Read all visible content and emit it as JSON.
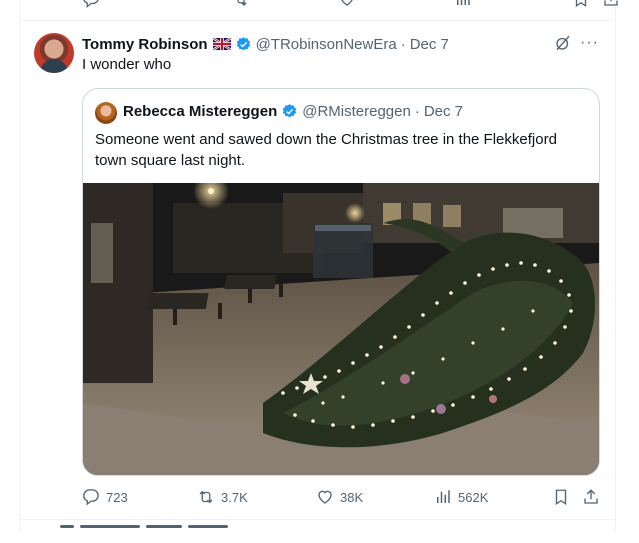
{
  "previous_tweet_bar": {
    "reply_count": "",
    "retweet_count": "",
    "like_count": "",
    "view_count": "",
    "reply_icon": "reply-icon",
    "retweet_icon": "retweet-icon",
    "like_icon": "heart-icon",
    "views_icon": "views-icon"
  },
  "tweet": {
    "author_name": "Tommy Robinson",
    "flag_icon": "uk-flag-icon",
    "verified_icon": "verified-badge-icon",
    "handle": "@TRobinsonNewEra",
    "separator": "·",
    "date": "Dec 7",
    "text": "I wonder who",
    "grok_icon": "grok-icon",
    "more_icon": "more-icon",
    "more_label": "···"
  },
  "quoted_tweet": {
    "author_name": "Rebecca Mistereggen",
    "verified_icon": "verified-badge-icon",
    "handle": "@RMistereggen",
    "separator": "·",
    "date": "Dec 7",
    "text": "Someone went and sawed down the Christmas tree in the Flekkefjord town square last night."
  },
  "actions": {
    "replies": "723",
    "retweets": "3.7K",
    "likes": "38K",
    "views": "562K",
    "reply_icon": "reply-icon",
    "retweet_icon": "retweet-icon",
    "like_icon": "heart-icon",
    "views_icon": "views-icon",
    "bookmark_icon": "bookmark-icon",
    "share_icon": "share-icon"
  },
  "colors": {
    "text_primary": "#0f1419",
    "text_secondary": "#536471",
    "verified_blue": "#1d9bf0",
    "border": "#cfd9de"
  }
}
